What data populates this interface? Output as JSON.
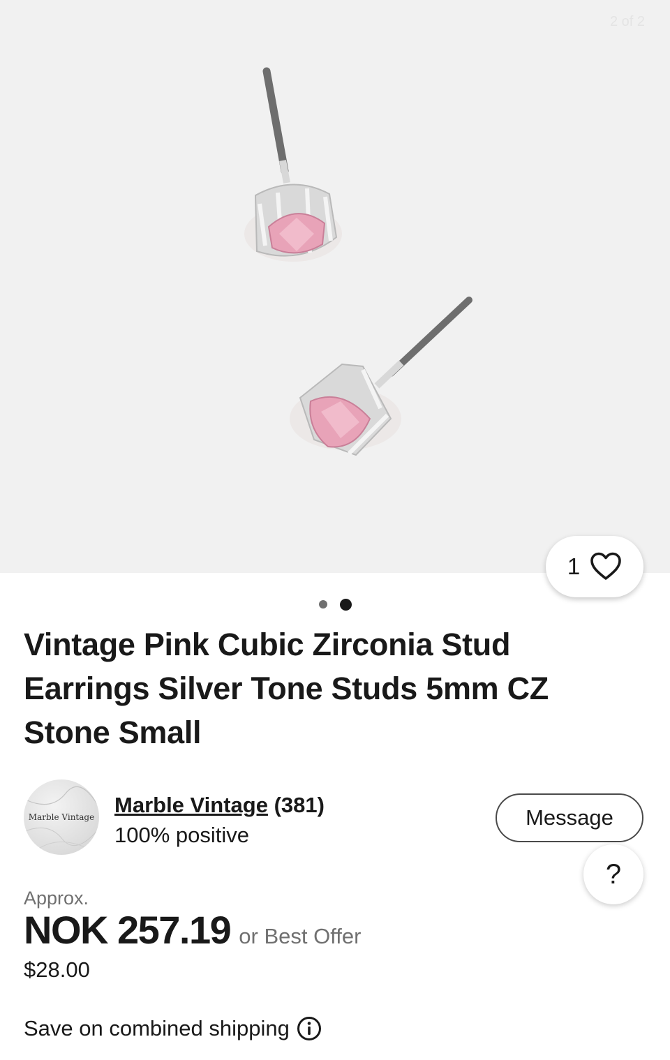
{
  "gallery": {
    "counter": "2 of 2",
    "watch_count": "1",
    "dots_total": 2,
    "active_dot": 2
  },
  "listing": {
    "title": "Vintage Pink Cubic Zirconia Stud Earrings Silver Tone Studs 5mm CZ Stone Small"
  },
  "seller": {
    "avatar_text": "Marble Vintage",
    "name": "Marble Vintage",
    "feedback_count": "(381)",
    "feedback_percent": "100% positive",
    "message_label": "Message"
  },
  "help": {
    "label": "?"
  },
  "price": {
    "approx_label": "Approx.",
    "amount": "NOK 257.19",
    "best_offer": "or Best Offer",
    "original": "$28.00"
  },
  "shipping": {
    "label": "Save on combined shipping"
  },
  "icons": {
    "watch": "heart-icon",
    "info": "info-icon"
  },
  "colors": {
    "text": "#191919",
    "muted": "#707070",
    "gallery_bg": "#f1f1f1",
    "stone_pink": "#e8a3b8"
  }
}
